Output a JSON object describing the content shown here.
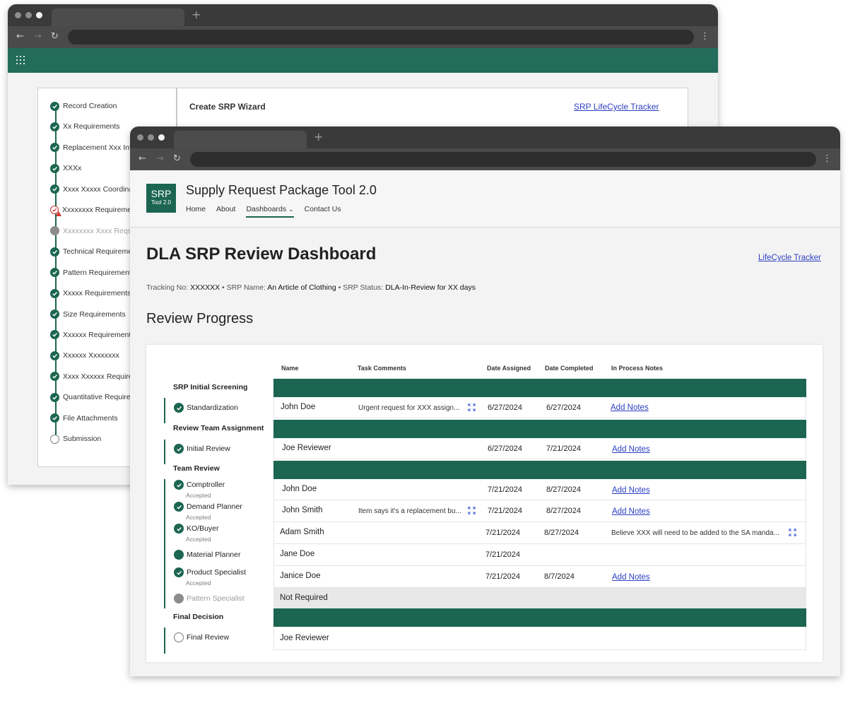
{
  "back_window": {
    "wizard_steps": [
      {
        "label": "Record Creation",
        "status": "complete"
      },
      {
        "label": "Xx Requirements",
        "status": "complete"
      },
      {
        "label": "Replacement Xxx Info",
        "status": "complete"
      },
      {
        "label": "XXXx",
        "status": "complete"
      },
      {
        "label": "Xxxx Xxxxx Coordination",
        "status": "complete"
      },
      {
        "label": "Xxxxxxxx Requirements",
        "status": "error"
      },
      {
        "label": "Xxxxxxxx Xxxx Reqs",
        "status": "disabled"
      },
      {
        "label": "Technical Requirements",
        "status": "complete"
      },
      {
        "label": "Pattern Requirements",
        "status": "complete"
      },
      {
        "label": "Xxxxx Requirements",
        "status": "complete"
      },
      {
        "label": "Size Requirements",
        "status": "complete"
      },
      {
        "label": "Xxxxxx Requirements",
        "status": "complete"
      },
      {
        "label": "Xxxxxx Xxxxxxxx",
        "status": "complete"
      },
      {
        "label": "Xxxx Xxxxxx Requirements",
        "status": "complete"
      },
      {
        "label": "Quantitative Requirements",
        "status": "complete"
      },
      {
        "label": "File Attachments",
        "status": "complete"
      },
      {
        "label": "Submission",
        "status": "incomplete"
      }
    ],
    "wizard_title": "Create SRP Wizard",
    "lifecycle_link": "SRP LifeCycle Tracker"
  },
  "header": {
    "logo_main": "SRP",
    "logo_sub": "Tool 2.0",
    "site_title": "Supply Request Package Tool 2.0",
    "nav": {
      "home": "Home",
      "about": "About",
      "dashboards": "Dashboards",
      "contact": "Contact Us"
    }
  },
  "page": {
    "title": "DLA SRP Review Dashboard",
    "lifecycle_link": "LifeCycle Tracker",
    "tracking_label": "Tracking No:",
    "tracking_value": "XXXXXX",
    "srp_name_label": "SRP Name:",
    "srp_name_value": "An Article of Clothing",
    "srp_status_label": "SRP Status:",
    "srp_status_value": "DLA-In-Review for XX days",
    "separator": "•",
    "section_title": "Review Progress"
  },
  "table": {
    "columns": {
      "name": "Name",
      "task_comments": "Task Comments",
      "date_assigned": "Date Assigned",
      "date_completed": "Date Completed",
      "notes": "In Process Notes"
    },
    "add_notes_label": "Add Notes",
    "groups": {
      "screening": "SRP Initial Screening",
      "assignment": "Review Team Assignment",
      "team_review": "Team Review",
      "final": "Final Decision"
    },
    "rows": {
      "standardization": {
        "step": "Standardization",
        "name": "John Doe",
        "comment": "Urgent request for XXX assign...",
        "assigned": "6/27/2024",
        "completed": "6/27/2024"
      },
      "initial_review": {
        "step": "Initial Review",
        "name": "Joe Reviewer",
        "assigned": "6/27/2024",
        "completed": "7/21/2024"
      },
      "comptroller": {
        "step": "Comptroller",
        "sub": "Accepted",
        "name": "John Doe",
        "assigned": "7/21/2024",
        "completed": "8/27/2024"
      },
      "demand_planner": {
        "step": "Demand Planner",
        "sub": "Accepted",
        "name": "John Smith",
        "comment": "Item says it's a replacement bu...",
        "assigned": "7/21/2024",
        "completed": "8/27/2024"
      },
      "ko_buyer": {
        "step": "KO/Buyer",
        "sub": "Accepted",
        "name": "Adam Smith",
        "assigned": "7/21/2024",
        "completed": "8/27/2024",
        "note": "Believe XXX will need to be added to the SA manda..."
      },
      "material_planner": {
        "step": "Material Planner",
        "name": "Jane Doe",
        "assigned": "7/21/2024"
      },
      "product_specialist": {
        "step": "Product Specialist",
        "sub": "Accepted",
        "name": "Janice Doe",
        "assigned": "7/21/2024",
        "completed": "8/7/2024"
      },
      "pattern_specialist": {
        "step": "Pattern Specialist",
        "name": "Not Required"
      },
      "final_review": {
        "step": "Final Review",
        "name": "Joe Reviewer"
      }
    }
  },
  "colors": {
    "brand": "#1c6651",
    "strip": "#236b5a",
    "link": "#2b3fc2",
    "error": "#c9332c"
  }
}
